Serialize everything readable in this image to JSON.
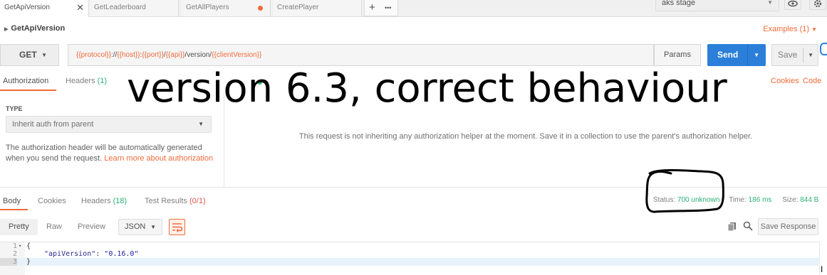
{
  "tabs": [
    {
      "label": "GetApiVersion",
      "active": true,
      "control": "close"
    },
    {
      "label": "GetLeaderboard",
      "active": false,
      "control": ""
    },
    {
      "label": "GetAllPlayers",
      "active": false,
      "control": "unsaved-dot"
    },
    {
      "label": "CreatePlayer",
      "active": false,
      "control": ""
    }
  ],
  "tab_actions": {
    "new": "+",
    "more": "•••"
  },
  "environment": {
    "selected": "aks stage"
  },
  "request": {
    "name": "GetApiVersion",
    "examples_label": "Examples (1)",
    "method": "GET",
    "url_parts": [
      {
        "text": "{{protocol}}",
        "var": true
      },
      {
        "text": "://",
        "var": false
      },
      {
        "text": "{{host}}",
        "var": true
      },
      {
        "text": ":",
        "var": false
      },
      {
        "text": "{{port}}",
        "var": true
      },
      {
        "text": "/",
        "var": false
      },
      {
        "text": "{{api}}",
        "var": true
      },
      {
        "text": "/version/",
        "var": false
      },
      {
        "text": "{{clientVersion}}",
        "var": true
      }
    ],
    "params_label": "Params",
    "send_label": "Send",
    "save_label": "Save"
  },
  "request_tabs": {
    "authorization": "Authorization",
    "headers": "Headers",
    "headers_count": "(1)",
    "cookies": "Cookies",
    "code": "Code"
  },
  "overlay_caption": "version 6.3, correct behaviour",
  "auth": {
    "type_label": "TYPE",
    "type_value": "Inherit auth from parent",
    "description": "The authorization header will be automatically generated when you send the request.",
    "learn_more": "Learn more about authorization",
    "message": "This request is not inheriting any authorization helper at the moment. Save it in a collection to use the parent's authorization helper."
  },
  "response_tabs": {
    "body": "Body",
    "cookies": "Cookies",
    "headers": "Headers",
    "headers_count": "(18)",
    "tests": "Test Results",
    "tests_count": "(0/1)"
  },
  "response_meta": {
    "status_label": "Status:",
    "status_value": "700 unknown",
    "time_label": "Time:",
    "time_value": "186 ms",
    "size_label": "Size:",
    "size_value": "844 B"
  },
  "format_bar": {
    "pretty": "Pretty",
    "raw": "Raw",
    "preview": "Preview",
    "format": "JSON",
    "save_response": "Save Response"
  },
  "code_lines": [
    {
      "num": "1",
      "fold": "▾",
      "text": "{"
    },
    {
      "num": "2",
      "fold": "",
      "key": "\"apiVersion\"",
      "value": "\"0.16.0\""
    },
    {
      "num": "3",
      "fold": "",
      "text": "}"
    }
  ],
  "colors": {
    "accent": "#f26b3a",
    "send": "#2b7fd9",
    "success": "#2cb175"
  }
}
